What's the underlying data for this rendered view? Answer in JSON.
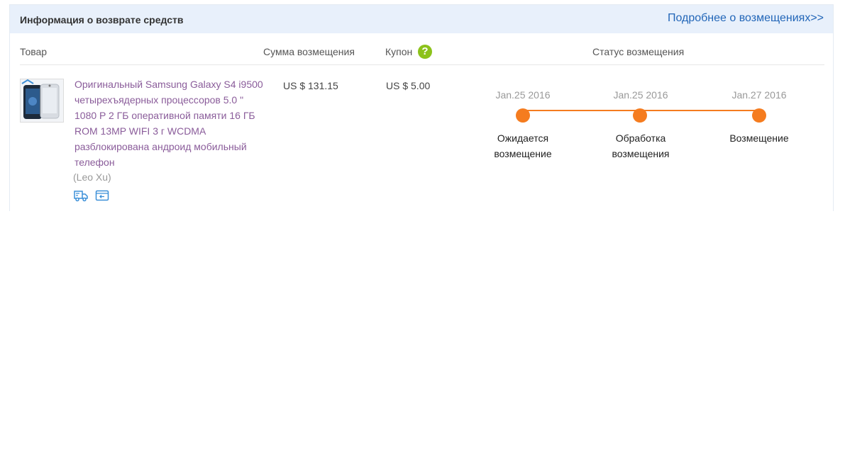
{
  "header": {
    "title": "Информация о возврате средств",
    "link": "Подробнее о возмещениях>>"
  },
  "columns": {
    "product": "Товар",
    "amount": "Сумма возмещения",
    "coupon": "Купон",
    "status": "Статус возмещения",
    "help_glyph": "?"
  },
  "order": {
    "product_name": "Оригинальный Samsung Galaxy S4 i9500 четырехъядерных процессоров 5.0 \" 1080 P 2 ГБ оперативной памяти 16 ГБ ROM 13MP WIFI 3 г WCDMA разблокирована андроид мобильный телефон",
    "seller": "(Leo Xu)",
    "refund_amount": "US $ 131.15",
    "coupon_amount": "US $ 5.00",
    "icons": [
      "shipping-truck-icon",
      "return-card-icon"
    ]
  },
  "timeline": {
    "color": "#f57c1f",
    "steps": [
      {
        "date": "Jan.25 2016",
        "label": "Ожидается возмещение"
      },
      {
        "date": "Jan.25 2016",
        "label": "Обработка возмещения"
      },
      {
        "date": "Jan.27 2016",
        "label": "Возмещение"
      }
    ]
  },
  "colors": {
    "header_bg": "#e8f0fb",
    "link": "#2266b8",
    "product_link": "#8a5c9a",
    "help_icon": "#8cc21a"
  }
}
